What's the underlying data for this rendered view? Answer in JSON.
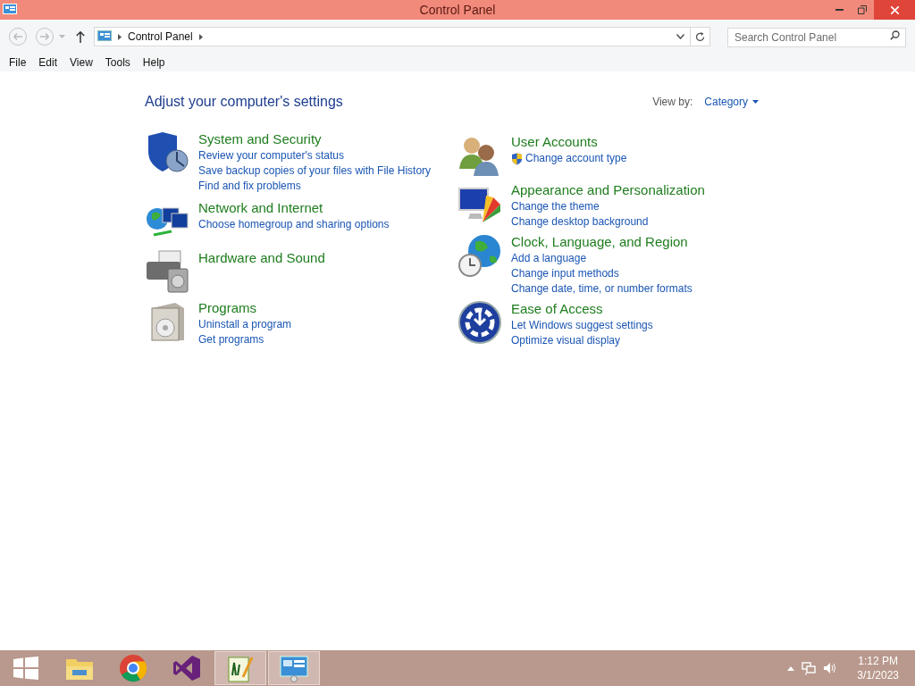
{
  "window": {
    "title": "Control Panel"
  },
  "address": {
    "crumb": "Control Panel",
    "search_placeholder": "Search Control Panel"
  },
  "menu": [
    "File",
    "Edit",
    "View",
    "Tools",
    "Help"
  ],
  "heading": "Adjust your computer's settings",
  "view_by": {
    "label": "View by:",
    "value": "Category"
  },
  "columns": [
    [
      {
        "kind": "security",
        "title": "System and Security",
        "links": [
          {
            "text": "Review your computer's status",
            "shield": false
          },
          {
            "text": "Save backup copies of your files with File History",
            "shield": false
          },
          {
            "text": "Find and fix problems",
            "shield": false
          }
        ]
      },
      {
        "kind": "network",
        "title": "Network and Internet",
        "links": [
          {
            "text": "Choose homegroup and sharing options",
            "shield": false
          }
        ]
      },
      {
        "kind": "hardware",
        "title": "Hardware and Sound"
      },
      {
        "kind": "programs",
        "title": "Programs",
        "links": [
          {
            "text": "Uninstall a program",
            "shield": false
          },
          {
            "text": "Get programs",
            "shield": false
          }
        ]
      }
    ],
    [
      {
        "kind": "users",
        "title": "User Accounts",
        "links": [
          {
            "text": "Change account type",
            "shield": true
          }
        ]
      },
      {
        "kind": "appearance",
        "title": "Appearance and Personalization",
        "links": [
          {
            "text": "Change the theme",
            "shield": false
          },
          {
            "text": "Change desktop background",
            "shield": false
          }
        ]
      },
      {
        "kind": "clock",
        "title": "Clock, Language, and Region",
        "links": [
          {
            "text": "Add a language",
            "shield": false
          },
          {
            "text": "Change input methods",
            "shield": false
          },
          {
            "text": "Change date, time, or number formats",
            "shield": false
          }
        ]
      },
      {
        "kind": "ease",
        "title": "Ease of Access",
        "links": [
          {
            "text": "Let Windows suggest settings",
            "shield": false
          },
          {
            "text": "Optimize visual display",
            "shield": false
          }
        ]
      }
    ]
  ],
  "taskbar": {
    "apps": [
      {
        "kind": "start",
        "selected": false
      },
      {
        "kind": "explorer",
        "selected": false
      },
      {
        "kind": "chrome",
        "selected": false
      },
      {
        "kind": "studio",
        "selected": false
      },
      {
        "kind": "notepad",
        "selected": true
      },
      {
        "kind": "panel",
        "selected": true
      }
    ],
    "time": "1:12 PM",
    "date": "3/1/2023"
  }
}
